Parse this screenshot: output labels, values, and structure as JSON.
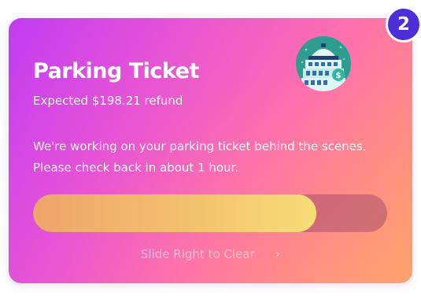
{
  "card": {
    "title": "Parking Ticket",
    "refund_text": "Expected $198.21 refund",
    "description": "We're working on your parking ticket behind the scenes. Please check back in about 1 hour.",
    "slide_label": "Slide Right to Clear",
    "slide_icon": "chevron-right-icon",
    "illustration_icon": "parking-garage-icon",
    "progress_fraction": 0.8
  },
  "badge": {
    "count": "2"
  },
  "colors": {
    "badge": "#4d2fd9",
    "gradient_start": "#c13cf3",
    "gradient_mid": "#ff6fae",
    "gradient_end": "#ffa06c",
    "progress_fill": "#f3c46e"
  }
}
